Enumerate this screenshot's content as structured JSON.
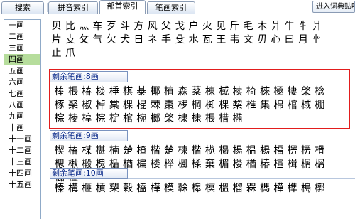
{
  "tabs": [
    {
      "label": "搜索",
      "active": false
    },
    {
      "label": "拼音索引",
      "active": false
    },
    {
      "label": "部首索引",
      "active": true
    },
    {
      "label": "笔画索引",
      "active": false
    }
  ],
  "add_button_label": "进入词典贴吧",
  "stroke_list": [
    {
      "label": "一画",
      "selected": false
    },
    {
      "label": "二画",
      "selected": false
    },
    {
      "label": "三画",
      "selected": false
    },
    {
      "label": "四画",
      "selected": true
    },
    {
      "label": "五画",
      "selected": false
    },
    {
      "label": "六画",
      "selected": false
    },
    {
      "label": "七画",
      "selected": false
    },
    {
      "label": "八画",
      "selected": false
    },
    {
      "label": "九画",
      "selected": false
    },
    {
      "label": "十画",
      "selected": false
    },
    {
      "label": "十一画",
      "selected": false
    },
    {
      "label": "十二画",
      "selected": false
    },
    {
      "label": "十三画",
      "selected": false
    },
    {
      "label": "十四画",
      "selected": false
    },
    {
      "label": "十五画",
      "selected": false
    }
  ],
  "radicals": {
    "rows": [
      [
        "贝",
        "比",
        "灬",
        "车",
        "歹",
        "斗",
        "方",
        "风",
        "父",
        "戈",
        "户",
        "火",
        "见",
        "斤",
        "毛",
        "木",
        "爿",
        "牛",
        "牜",
        "爿"
      ],
      [
        "片",
        "攴",
        "攵",
        "气",
        "欠",
        "犬",
        "日",
        "ネ",
        "手",
        "殳",
        "水",
        "瓦",
        "王",
        "韦",
        "文",
        "毋",
        "心",
        "曰",
        "月",
        "㣺"
      ],
      [
        "止",
        "爪"
      ]
    ]
  },
  "sections": [
    {
      "header": "剩余笔画:8画",
      "rows": [
        [
          "棒",
          "棖",
          "椿",
          "棪",
          "棰",
          "棋",
          "棊",
          "椰",
          "植",
          "森",
          "棻",
          "棟",
          "棫",
          "椟",
          "椅",
          "棶",
          "極",
          "棲",
          "棨",
          "棯"
        ],
        [
          "椓",
          "棸",
          "椒",
          "棹",
          "棠",
          "棵",
          "棍",
          "棘",
          "棗",
          "椤",
          "棡",
          "椥",
          "棵",
          "棃",
          "椎",
          "集",
          "棉",
          "棺",
          "棫",
          "棚"
        ],
        [
          "棕",
          "棱",
          "椁",
          "棕",
          "椗",
          "棺",
          "椀",
          "榔",
          "棨",
          "棣",
          "棣",
          "棖",
          "棤",
          "椭"
        ]
      ]
    },
    {
      "header": "剩余笔画:9画",
      "rows": [
        [
          "楔",
          "椿",
          "楳",
          "椹",
          "楠",
          "楚",
          "楂",
          "楷",
          "楚",
          "楝",
          "楷",
          "榄",
          "楬",
          "楊",
          "榅",
          "楊",
          "楅",
          "楞",
          "楞",
          "榾"
        ],
        [
          "楒",
          "楸",
          "椴",
          "槐",
          "楯",
          "楢",
          "楄",
          "楼",
          "榉",
          "楓",
          "楺",
          "棄",
          "楣",
          "楼",
          "楢",
          "椿",
          "楦",
          "楫",
          "榍",
          "榍"
        ],
        [
          "榀",
          "楹"
        ]
      ]
    },
    {
      "header": "剩余笔画:10画",
      "rows": [
        [
          "榛",
          "構",
          "榧",
          "槓",
          "槊",
          "榖",
          "榼",
          "樺",
          "模",
          "榦",
          "槔",
          "榠",
          "榲",
          "榴",
          "槑",
          "榪",
          "樺",
          "榫",
          "槝",
          "槨"
        ]
      ]
    }
  ]
}
